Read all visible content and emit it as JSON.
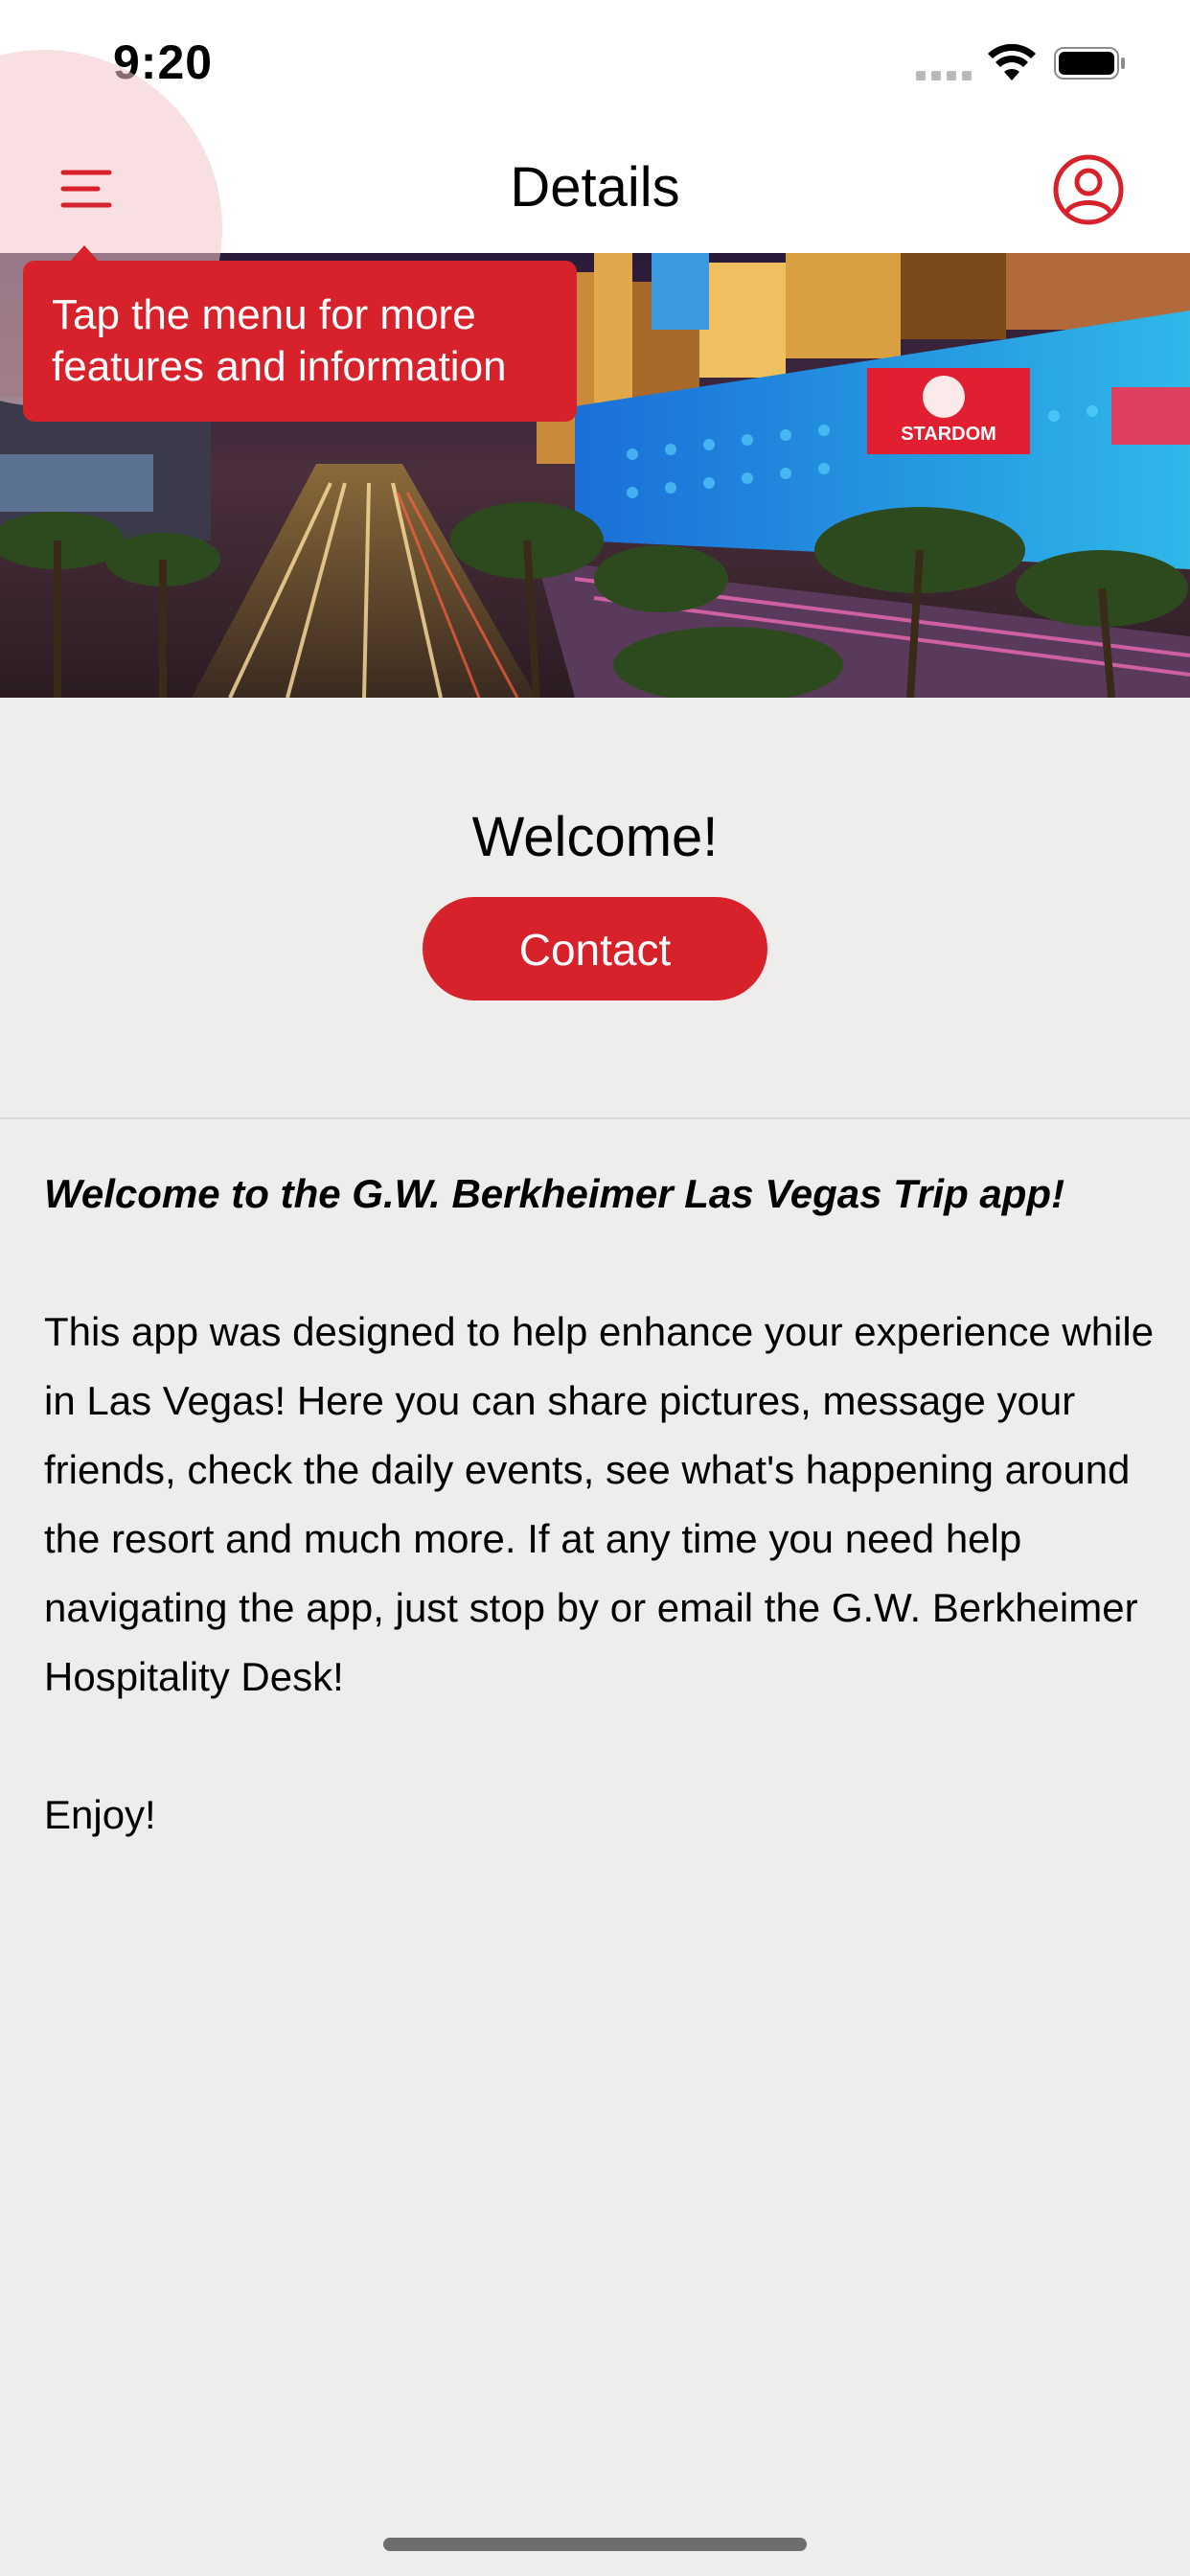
{
  "status_bar": {
    "time": "9:20"
  },
  "nav": {
    "title": "Details",
    "menu_icon": "hamburger-menu-icon",
    "profile_icon": "user-profile-icon",
    "accent_color": "#d7212b"
  },
  "tooltip": {
    "text": "Tap the menu for more features and information"
  },
  "welcome": {
    "title": "Welcome!",
    "contact_label": "Contact"
  },
  "body": {
    "intro": "Welcome to the G.W. Berkheimer Las Vegas Trip app!",
    "paragraph": "This app was designed to help enhance your experience while in Las Vegas! Here you can share pictures, message your friends, check the daily events, see what's happening around the resort and much more. If at any time you need help navigating the app, just stop by or email the G.W. Berkheimer Hospitality Desk!",
    "closing": "Enjoy!"
  },
  "hero": {
    "sign_text": "STARDOM"
  }
}
